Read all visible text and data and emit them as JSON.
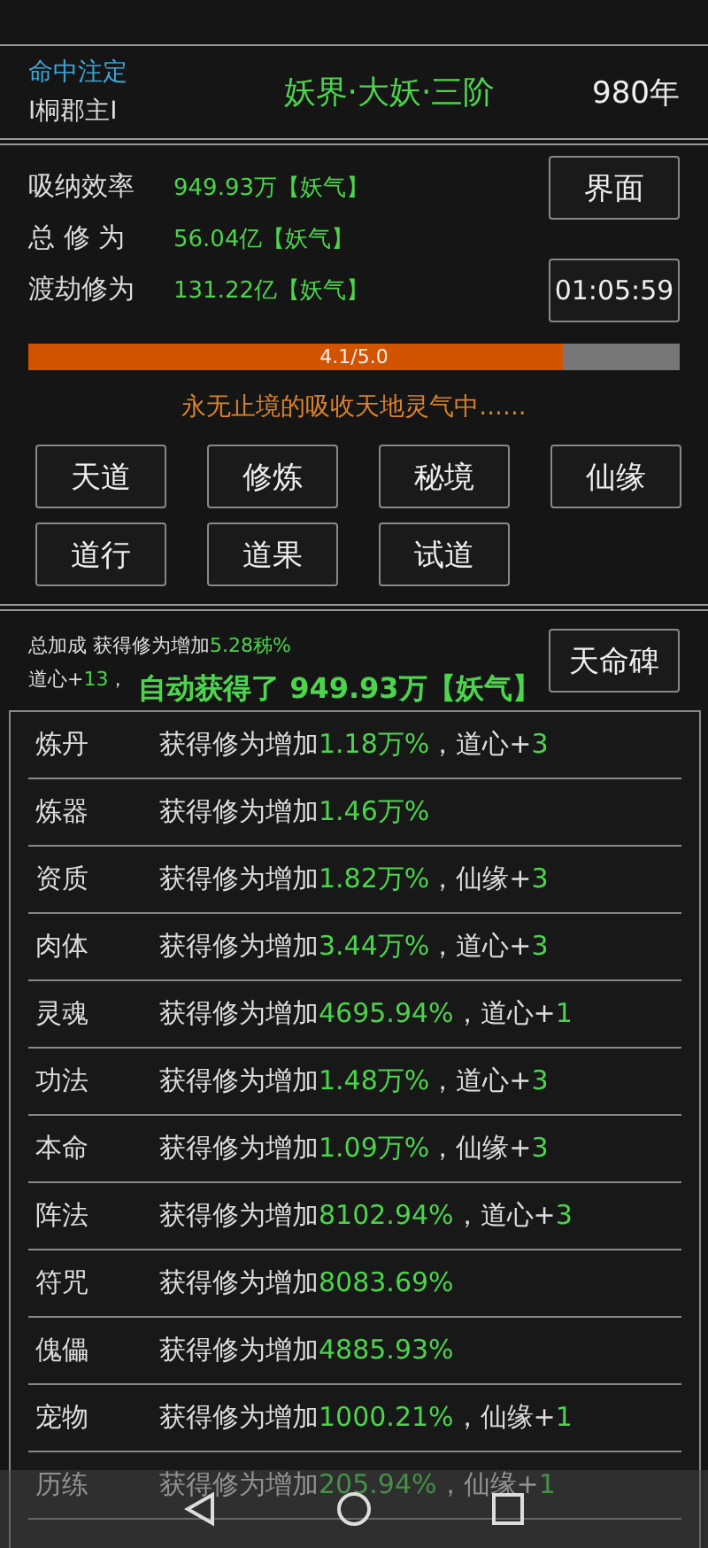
{
  "header": {
    "title_tag": "命中注定",
    "title_name": "I桐郡主I",
    "realm": "妖界·大妖·三阶",
    "years": "980年"
  },
  "stats": [
    {
      "label": "吸纳效率",
      "value": "949.93万【妖气】"
    },
    {
      "label": "总 修 为",
      "value": "56.04亿【妖气】"
    },
    {
      "label": "渡劫修为",
      "value": "131.22亿【妖气】"
    }
  ],
  "side_buttons": [
    "界面",
    "01:05:59"
  ],
  "progress": {
    "level": 0.82,
    "reading": "4.1/5.0"
  },
  "status_text": "永无止境的吸收天地灵气中......",
  "menu_buttons": [
    "天道",
    "修炼",
    "秘境",
    "仙缘",
    "道行",
    "道果",
    "试道"
  ],
  "bonus": {
    "label": "总加成 获得修为增加",
    "value": "5.28秭%",
    "dao_label": "道心+",
    "dao_value": "13",
    "dao_tail": "，"
  },
  "stele_button": "天命碑",
  "toast": "自动获得了 949.93万【妖气】",
  "rows": [
    {
      "name": "炼丹",
      "prefix": "获得修为增加",
      "value": "1.18万%",
      "extra_label": "，道心+",
      "extra_value": "3"
    },
    {
      "name": "炼器",
      "prefix": "获得修为增加",
      "value": "1.46万%"
    },
    {
      "name": "资质",
      "prefix": "获得修为增加",
      "value": "1.82万%",
      "extra_label": "，仙缘+",
      "extra_value": "3"
    },
    {
      "name": "肉体",
      "prefix": "获得修为增加",
      "value": "3.44万%",
      "extra_label": "，道心+",
      "extra_value": "3"
    },
    {
      "name": "灵魂",
      "prefix": "获得修为增加",
      "value": "4695.94%",
      "extra_label": "，道心+",
      "extra_value": "1"
    },
    {
      "name": "功法",
      "prefix": "获得修为增加",
      "value": "1.48万%",
      "extra_label": "，道心+",
      "extra_value": "3"
    },
    {
      "name": "本命",
      "prefix": "获得修为增加",
      "value": "1.09万%",
      "extra_label": "，仙缘+",
      "extra_value": "3"
    },
    {
      "name": "阵法",
      "prefix": "获得修为增加",
      "value": "8102.94%",
      "extra_label": "，道心+",
      "extra_value": "3"
    },
    {
      "name": "符咒",
      "prefix": "获得修为增加",
      "value": "8083.69%"
    },
    {
      "name": "傀儡",
      "prefix": "获得修为增加",
      "value": "4885.93%"
    },
    {
      "name": "宠物",
      "prefix": "获得修为增加",
      "value": "1000.21%",
      "extra_label": "，仙缘+",
      "extra_value": "1"
    },
    {
      "name": "历练",
      "prefix": "获得修为增加",
      "value": "205.94%",
      "extra_label": "，仙缘+",
      "extra_value": "1"
    }
  ]
}
